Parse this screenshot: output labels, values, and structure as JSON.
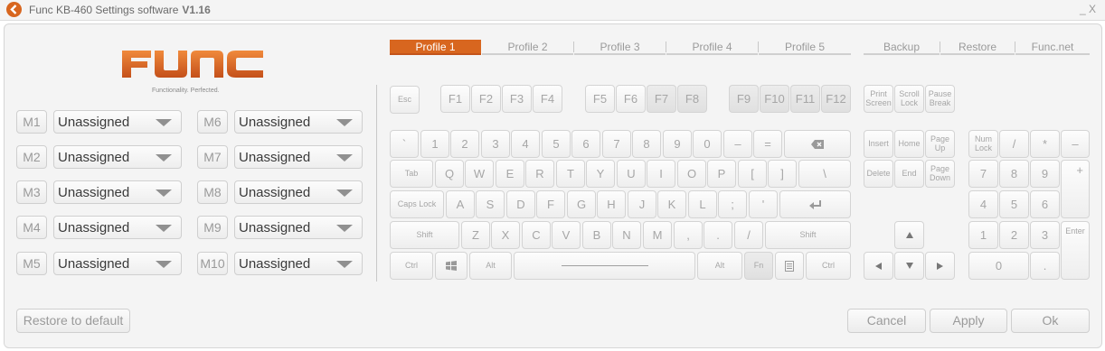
{
  "titlebar": {
    "title": "Func KB-460 Settings software",
    "version": "V1.16",
    "close": "_ X"
  },
  "logo": {
    "text": "FUNC",
    "tagline": "Functionality. Perfected."
  },
  "colors": {
    "accent": "#d8661f",
    "panel": "#f4f4f4"
  },
  "macros": [
    {
      "label": "M1",
      "value": "Unassigned"
    },
    {
      "label": "M2",
      "value": "Unassigned"
    },
    {
      "label": "M3",
      "value": "Unassigned"
    },
    {
      "label": "M4",
      "value": "Unassigned"
    },
    {
      "label": "M5",
      "value": "Unassigned"
    },
    {
      "label": "M6",
      "value": "Unassigned"
    },
    {
      "label": "M7",
      "value": "Unassigned"
    },
    {
      "label": "M8",
      "value": "Unassigned"
    },
    {
      "label": "M9",
      "value": "Unassigned"
    },
    {
      "label": "M10",
      "value": "Unassigned"
    }
  ],
  "profiles": [
    "Profile 1",
    "Profile 2",
    "Profile 3",
    "Profile 4",
    "Profile 5"
  ],
  "active_profile": "Profile 1",
  "links": [
    "Backup",
    "Restore",
    "Func.net"
  ],
  "keys": {
    "esc": "Esc",
    "f": [
      "F1",
      "F2",
      "F3",
      "F4",
      "F5",
      "F6",
      "F7",
      "F8",
      "F9",
      "F10",
      "F11",
      "F12"
    ],
    "printscreen": "Print Screen",
    "scrolllock": "Scroll Lock",
    "pausebreak": "Pause Break",
    "num_row": [
      "`",
      "1",
      "2",
      "3",
      "4",
      "5",
      "6",
      "7",
      "8",
      "9",
      "0",
      "–",
      "="
    ],
    "backspace_icon": "backspace-icon",
    "tab": "Tab",
    "q_row": [
      "Q",
      "W",
      "E",
      "R",
      "T",
      "Y",
      "U",
      "I",
      "O",
      "P",
      "[",
      "]",
      "\\"
    ],
    "caps": "Caps Lock",
    "a_row": [
      "A",
      "S",
      "D",
      "F",
      "G",
      "H",
      "J",
      "K",
      "L",
      ";",
      "'"
    ],
    "enter_icon": "enter-icon",
    "shift": "Shift",
    "z_row": [
      "Z",
      "X",
      "C",
      "V",
      "B",
      "N",
      "M",
      ",",
      ".",
      "/"
    ],
    "ctrl": "Ctrl",
    "alt": "Alt",
    "fn": "Fn",
    "win_icon": "windows-icon",
    "menu_icon": "menu-icon",
    "nav": [
      "Insert",
      "Home",
      "Page Up",
      "Delete",
      "End",
      "Page Down"
    ],
    "arrow_icons": [
      "up-arrow-icon",
      "left-arrow-icon",
      "down-arrow-icon",
      "right-arrow-icon"
    ],
    "numpad": {
      "numlock": "Num Lock",
      "slash": "/",
      "star": "*",
      "minus": "–",
      "row7": [
        "7",
        "8",
        "9"
      ],
      "plus": "+",
      "row4": [
        "4",
        "5",
        "6"
      ],
      "row1": [
        "1",
        "2",
        "3"
      ],
      "enter": "Enter",
      "zero": "0",
      "dot": "."
    }
  },
  "bottom": {
    "restore": "Restore to default",
    "cancel": "Cancel",
    "apply": "Apply",
    "ok": "Ok"
  }
}
